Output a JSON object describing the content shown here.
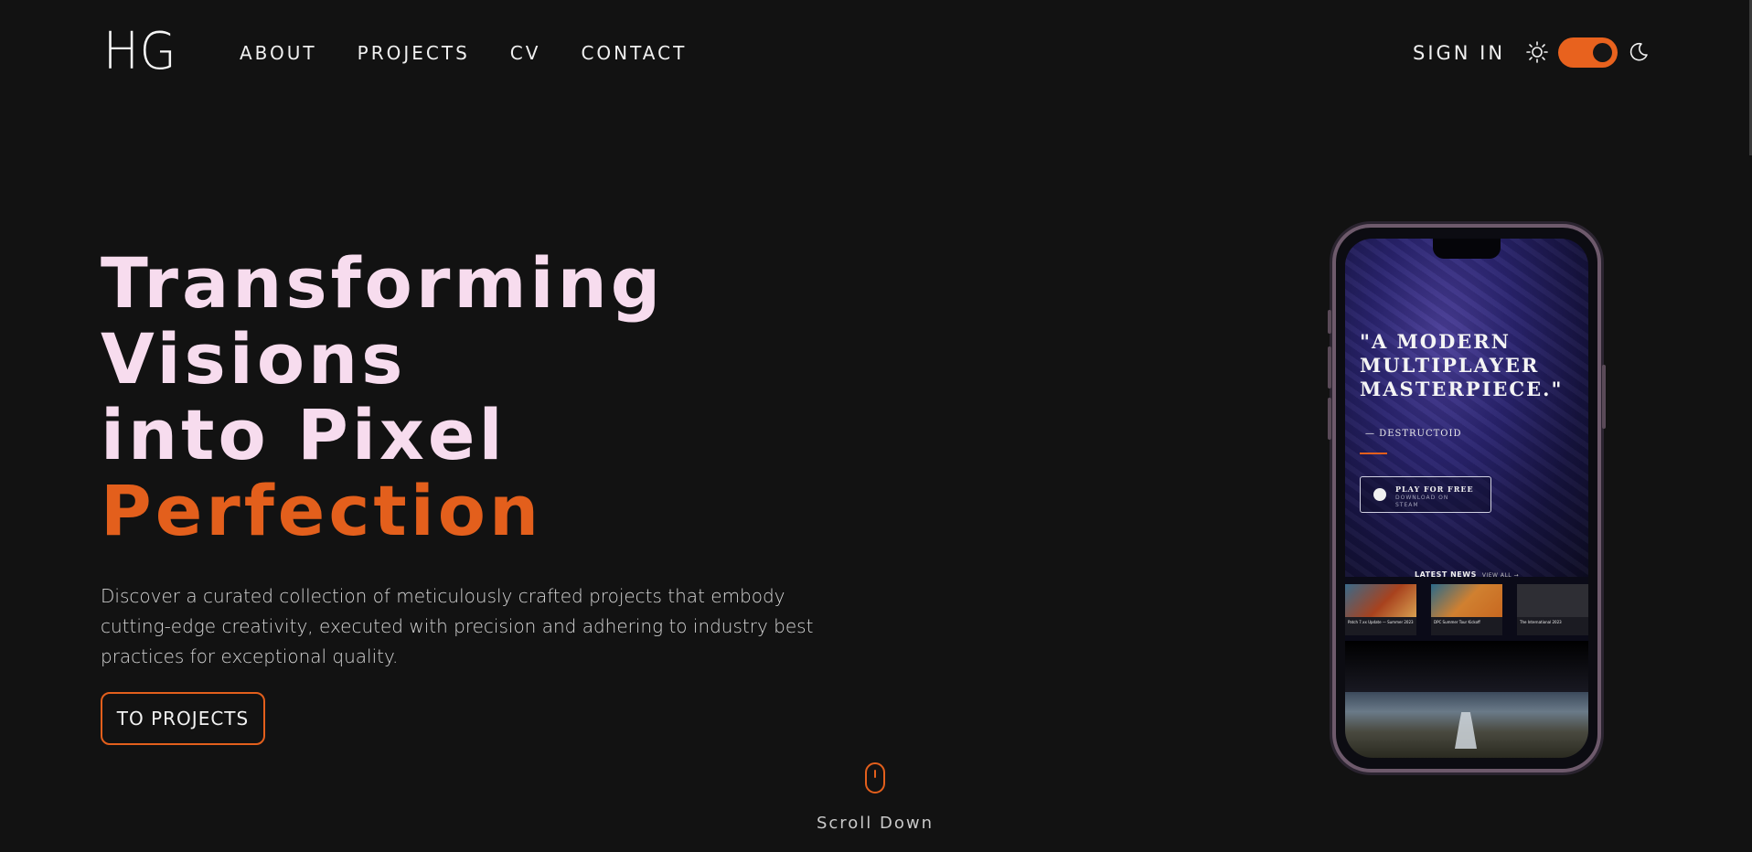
{
  "header": {
    "logo": "HG",
    "nav": [
      "ABOUT",
      "PROJECTS",
      "CV",
      "CONTACT"
    ],
    "sign_in": "SIGN IN",
    "theme_toggle": {
      "state": "dark",
      "accent": "#e8621e"
    }
  },
  "hero": {
    "title_lines": [
      "Transforming",
      "Visions",
      "into Pixel"
    ],
    "title_accent": "Perfection",
    "description": "Discover a curated collection of meticulously crafted projects that embody cutting-edge creativity, executed with precision and adhering to industry best practices for exceptional quality.",
    "cta_label": "TO PROJECTS",
    "scroll_label": "Scroll Down"
  },
  "phone_preview": {
    "quote": "\"A MODERN MULTIPLAYER MASTERPIECE.\"",
    "quote_source": "— DESTRUCTOID",
    "play_button": {
      "line1": "PLAY FOR FREE",
      "line2": "DOWNLOAD ON STEAM"
    },
    "news_header": "LATEST NEWS",
    "view_all": "VIEW ALL →",
    "news": [
      {
        "title": "Patch 7.xx Update — Summer 2023"
      },
      {
        "title": "DPC Summer Tour Kickoff"
      },
      {
        "title": "The International 2023"
      }
    ]
  },
  "colors": {
    "background": "#121212",
    "accent": "#e35f1c",
    "title": "#f7dcee"
  }
}
